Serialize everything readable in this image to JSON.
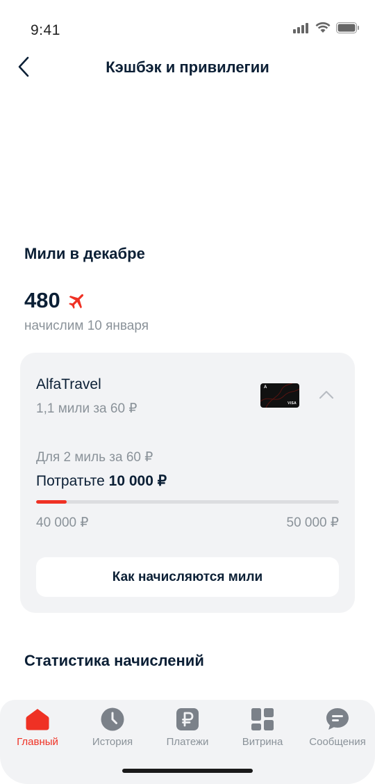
{
  "status_bar": {
    "time": "9:41"
  },
  "nav": {
    "title": "Кэшбэк и привилегии"
  },
  "miles": {
    "section_title": "Мили в декабре",
    "value": "480",
    "subtitle": "начислим 10 января"
  },
  "card": {
    "name": "AlfaTravel",
    "rate": "1,1 мили за 60 ₽",
    "image_logo": "A",
    "image_brand": "VISA",
    "target_label": "Для 2 миль за 60 ₽",
    "spend_prefix": "Потратьте",
    "spend_amount": "10 000 ₽",
    "progress_fraction": 0.1,
    "range_from": "40 000 ₽",
    "range_to": "50 000 ₽",
    "how_button": "Как начисляются мили"
  },
  "stats": {
    "section_title": "Статистика начислений"
  },
  "tabbar": {
    "items": [
      {
        "label": "Главный",
        "icon": "home-icon",
        "active": true
      },
      {
        "label": "История",
        "icon": "clock-icon",
        "active": false
      },
      {
        "label": "Платежи",
        "icon": "ruble-icon",
        "active": false
      },
      {
        "label": "Витрина",
        "icon": "grid-icon",
        "active": false
      },
      {
        "label": "Сообщения",
        "icon": "chat-icon",
        "active": false
      }
    ]
  },
  "colors": {
    "accent": "#ef3124",
    "text": "#0b1f35",
    "secondary": "#8a9299",
    "card_bg": "#f2f3f5"
  }
}
